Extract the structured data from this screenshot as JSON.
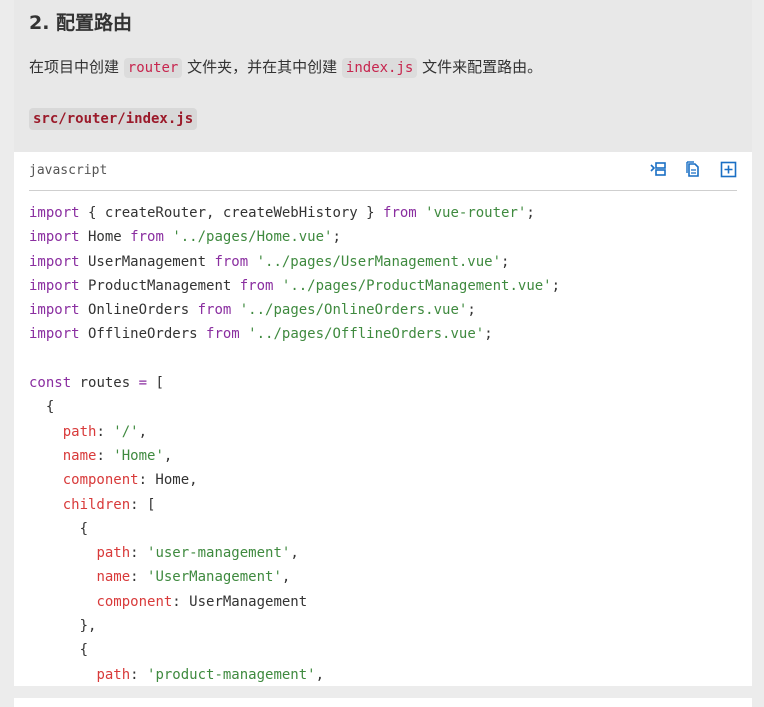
{
  "section": {
    "title": "2. 配置路由"
  },
  "intro": {
    "text1": "在项目中创建 ",
    "code1": "router",
    "text2": " 文件夹，并在其中创建 ",
    "code2": "index.js",
    "text3": " 文件来配置路由。"
  },
  "file_path": "src/router/index.js",
  "codeblock": {
    "language": "javascript",
    "toolbar": {
      "icons": [
        "collapse-icon",
        "copy-icon",
        "add-icon"
      ]
    },
    "lines": [
      [
        [
          "k",
          "import"
        ],
        [
          "n",
          " { createRouter, createWebHistory } "
        ],
        [
          "k",
          "from"
        ],
        [
          "n",
          " "
        ],
        [
          "s",
          "'vue-router'"
        ],
        [
          "n",
          ";"
        ]
      ],
      [
        [
          "k",
          "import"
        ],
        [
          "n",
          " Home "
        ],
        [
          "k",
          "from"
        ],
        [
          "n",
          " "
        ],
        [
          "s",
          "'../pages/Home.vue'"
        ],
        [
          "n",
          ";"
        ]
      ],
      [
        [
          "k",
          "import"
        ],
        [
          "n",
          " UserManagement "
        ],
        [
          "k",
          "from"
        ],
        [
          "n",
          " "
        ],
        [
          "s",
          "'../pages/UserManagement.vue'"
        ],
        [
          "n",
          ";"
        ]
      ],
      [
        [
          "k",
          "import"
        ],
        [
          "n",
          " ProductManagement "
        ],
        [
          "k",
          "from"
        ],
        [
          "n",
          " "
        ],
        [
          "s",
          "'../pages/ProductManagement.vue'"
        ],
        [
          "n",
          ";"
        ]
      ],
      [
        [
          "k",
          "import"
        ],
        [
          "n",
          " OnlineOrders "
        ],
        [
          "k",
          "from"
        ],
        [
          "n",
          " "
        ],
        [
          "s",
          "'../pages/OnlineOrders.vue'"
        ],
        [
          "n",
          ";"
        ]
      ],
      [
        [
          "k",
          "import"
        ],
        [
          "n",
          " OfflineOrders "
        ],
        [
          "k",
          "from"
        ],
        [
          "n",
          " "
        ],
        [
          "s",
          "'../pages/OfflineOrders.vue'"
        ],
        [
          "n",
          ";"
        ]
      ],
      [],
      [
        [
          "k",
          "const"
        ],
        [
          "n",
          " routes "
        ],
        [
          "k",
          "="
        ],
        [
          "n",
          " ["
        ]
      ],
      [
        [
          "n",
          "  {"
        ]
      ],
      [
        [
          "n",
          "    "
        ],
        [
          "p",
          "path"
        ],
        [
          "n",
          ": "
        ],
        [
          "s",
          "'/'"
        ],
        [
          "n",
          ","
        ]
      ],
      [
        [
          "n",
          "    "
        ],
        [
          "p",
          "name"
        ],
        [
          "n",
          ": "
        ],
        [
          "s",
          "'Home'"
        ],
        [
          "n",
          ","
        ]
      ],
      [
        [
          "n",
          "    "
        ],
        [
          "p",
          "component"
        ],
        [
          "n",
          ": Home,"
        ]
      ],
      [
        [
          "n",
          "    "
        ],
        [
          "p",
          "children"
        ],
        [
          "n",
          ": ["
        ]
      ],
      [
        [
          "n",
          "      {"
        ]
      ],
      [
        [
          "n",
          "        "
        ],
        [
          "p",
          "path"
        ],
        [
          "n",
          ": "
        ],
        [
          "s",
          "'user-management'"
        ],
        [
          "n",
          ","
        ]
      ],
      [
        [
          "n",
          "        "
        ],
        [
          "p",
          "name"
        ],
        [
          "n",
          ": "
        ],
        [
          "s",
          "'UserManagement'"
        ],
        [
          "n",
          ","
        ]
      ],
      [
        [
          "n",
          "        "
        ],
        [
          "p",
          "component"
        ],
        [
          "n",
          ": UserManagement"
        ]
      ],
      [
        [
          "n",
          "      },"
        ]
      ],
      [
        [
          "n",
          "      {"
        ]
      ],
      [
        [
          "n",
          "        "
        ],
        [
          "p",
          "path"
        ],
        [
          "n",
          ": "
        ],
        [
          "s",
          "'product-management'"
        ],
        [
          "n",
          ","
        ]
      ]
    ]
  }
}
